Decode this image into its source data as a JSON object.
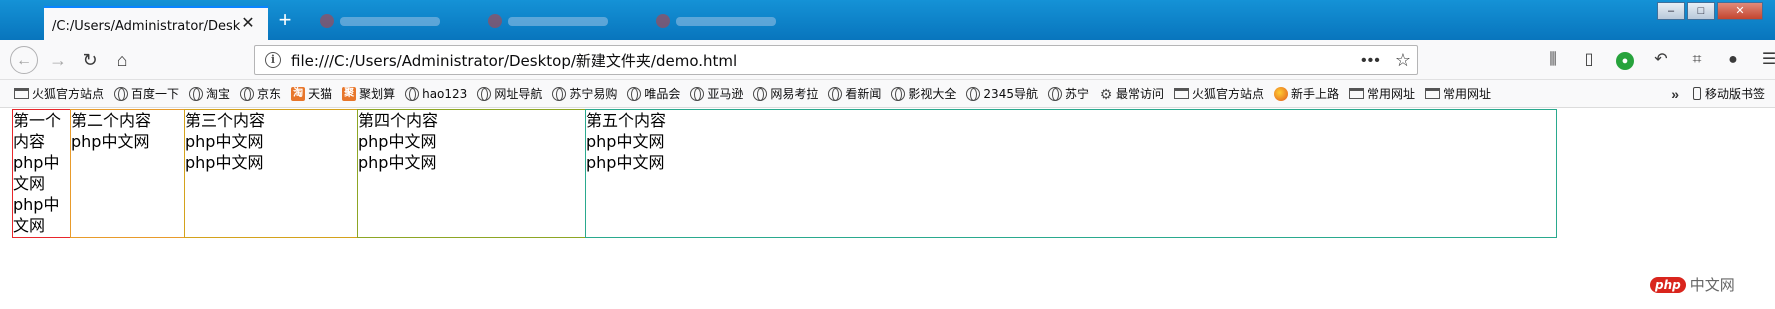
{
  "window": {
    "controls": [
      "–",
      "□",
      "✕"
    ]
  },
  "tabs": {
    "active_title": "/C:/Users/Administrator/Desktop/新建文件夹/demo.html",
    "close_glyph": "✕",
    "new_tab_glyph": "+"
  },
  "navigation": {
    "back_icon": "arrow-left-icon",
    "forward_icon": "arrow-right-icon",
    "reload_icon": "reload-icon",
    "home_icon": "home-icon",
    "url": "file:///C:/Users/Administrator/Desktop/新建文件夹/demo.html",
    "more_glyph": "•••",
    "star_glyph": "☆"
  },
  "bookmarks": {
    "items": [
      {
        "label": "火狐官方站点",
        "icon": "folder"
      },
      {
        "label": "百度一下",
        "icon": "globe"
      },
      {
        "label": "淘宝",
        "icon": "globe"
      },
      {
        "label": "京东",
        "icon": "globe"
      },
      {
        "label": "天猫",
        "icon": "orange",
        "glyph": "淘"
      },
      {
        "label": "聚划算",
        "icon": "orange",
        "glyph": "聚"
      },
      {
        "label": "hao123",
        "icon": "globe"
      },
      {
        "label": "网址导航",
        "icon": "globe"
      },
      {
        "label": "苏宁易购",
        "icon": "globe"
      },
      {
        "label": "唯品会",
        "icon": "globe"
      },
      {
        "label": "亚马逊",
        "icon": "globe"
      },
      {
        "label": "网易考拉",
        "icon": "globe"
      },
      {
        "label": "看新闻",
        "icon": "globe"
      },
      {
        "label": "影视大全",
        "icon": "globe"
      },
      {
        "label": "2345导航",
        "icon": "globe"
      },
      {
        "label": "苏宁",
        "icon": "globe"
      },
      {
        "label": "最常访问",
        "icon": "gear",
        "glyph": "⚙"
      },
      {
        "label": "火狐官方站点",
        "icon": "folder"
      },
      {
        "label": "新手上路",
        "icon": "firefox"
      },
      {
        "label": "常用网址",
        "icon": "folder"
      },
      {
        "label": "常用网址",
        "icon": "folder"
      }
    ],
    "overflow_glyph": "»",
    "mobile_label": "移动版书签"
  },
  "columns": [
    {
      "title": "第一个内容",
      "lines": [
        "php中文网",
        "php中文网"
      ],
      "border": "#e8262b"
    },
    {
      "title": "第二个内容",
      "lines": [
        "php中文网"
      ],
      "border": "#e89b2b"
    },
    {
      "title": "第三个内容",
      "lines": [
        "php中文网",
        "php中文网"
      ],
      "border": "#d4a21c"
    },
    {
      "title": "第四个内容",
      "lines": [
        "php中文网",
        "php中文网"
      ],
      "border": "#8da624"
    },
    {
      "title": "第五个内容",
      "lines": [
        "php中文网",
        "php中文网"
      ],
      "border": "#2aa98e"
    }
  ],
  "watermark": {
    "logo": "php",
    "text": "中文网"
  }
}
